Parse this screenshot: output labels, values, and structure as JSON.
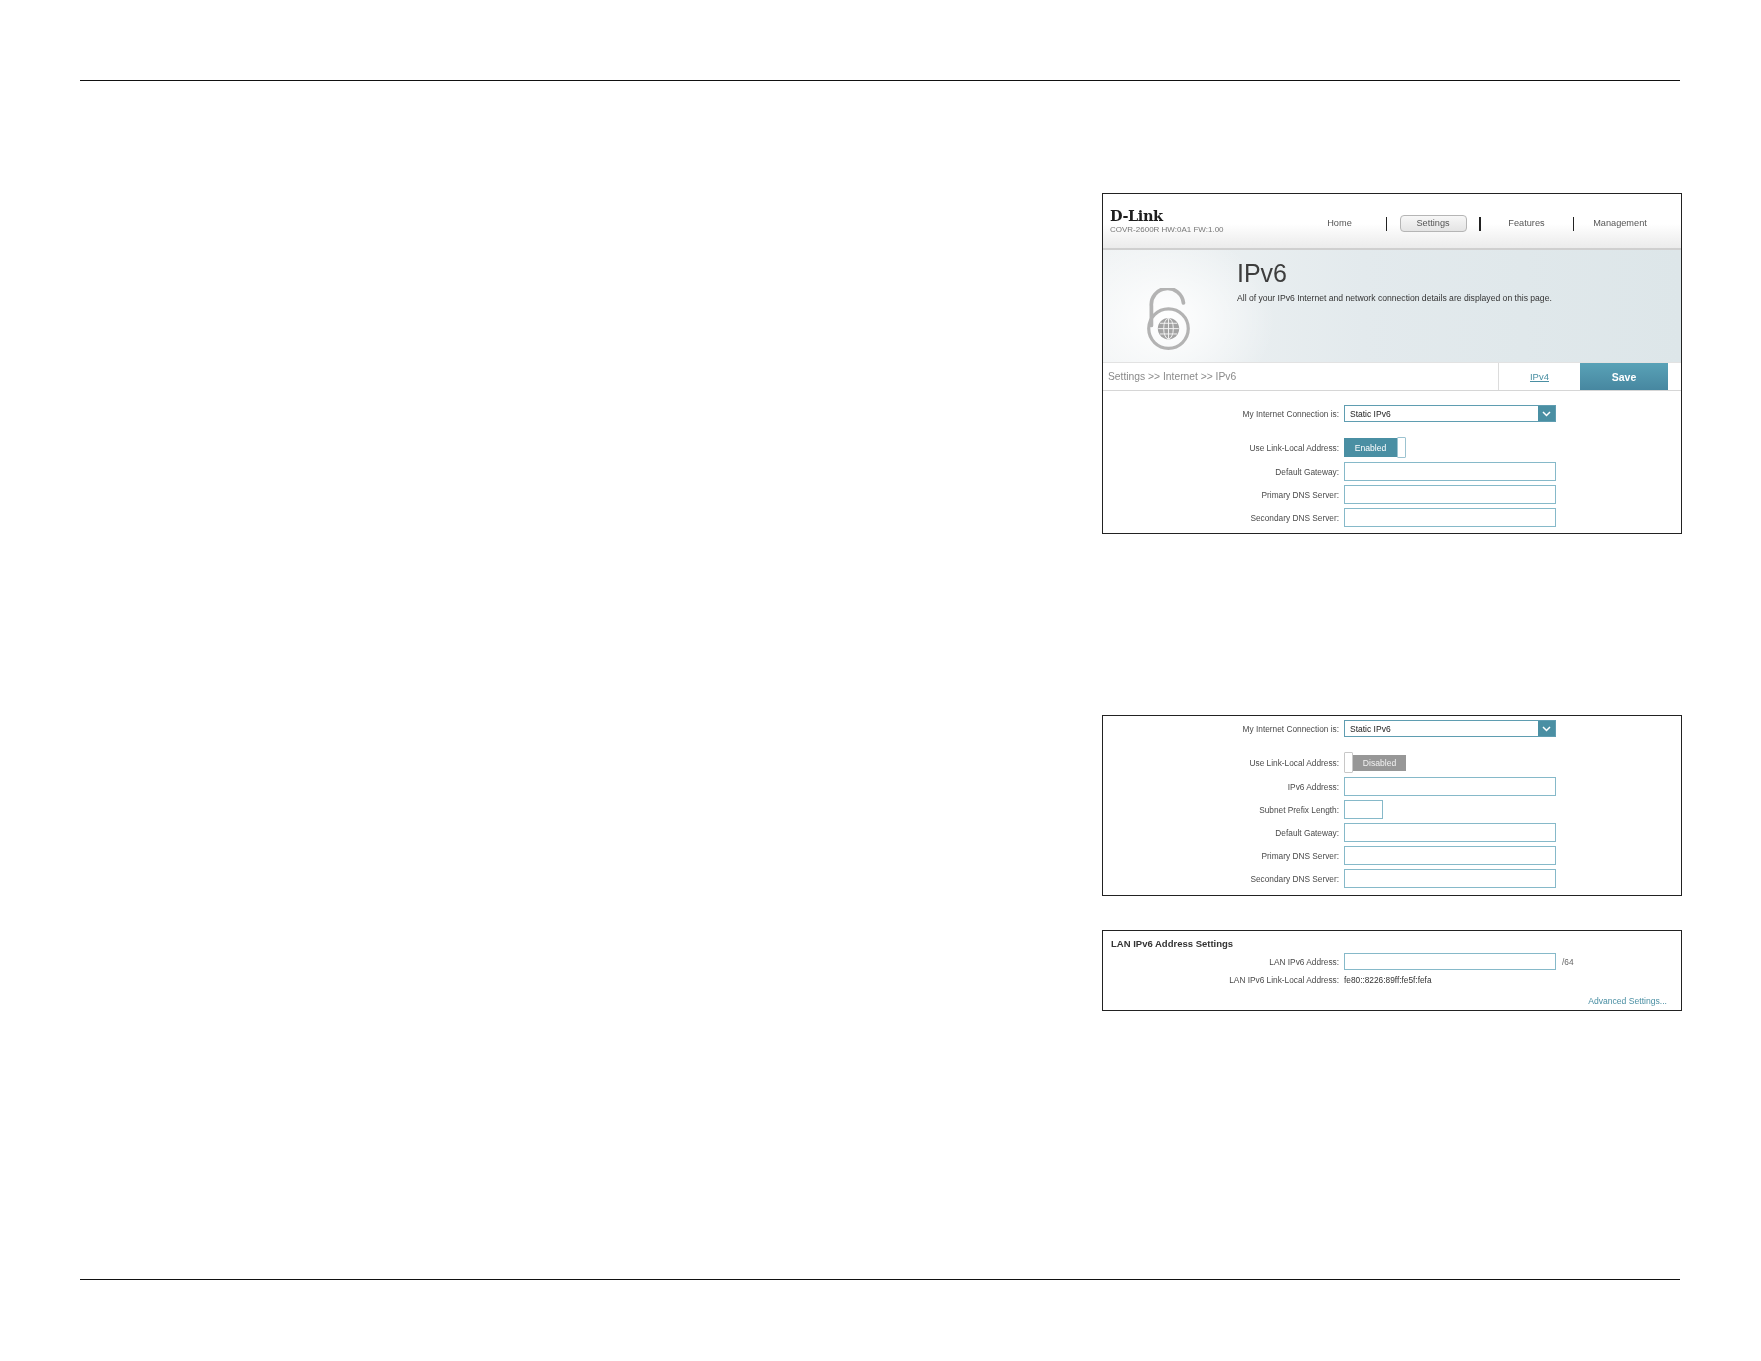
{
  "router_page": {
    "header": {
      "logo": "D-Link",
      "model": "COVR-2600R HW:0A1 FW:1.00",
      "nav": [
        {
          "label": "Home",
          "selected": false
        },
        {
          "label": "Settings",
          "selected": true
        },
        {
          "label": "Features",
          "selected": false
        },
        {
          "label": "Management",
          "selected": false
        }
      ]
    },
    "banner": {
      "title": "IPv6",
      "description": "All of your IPv6 Internet and network connection details are displayed on this page."
    },
    "breadcrumb_bar": {
      "path": "Settings >> Internet >> IPv6",
      "link": "IPv4",
      "save_button": "Save"
    },
    "fields": [
      {
        "kind": "select",
        "label": "My Internet Connection is:",
        "value": "Static IPv6"
      },
      {
        "kind": "toggle",
        "label": "Use Link-Local Address:",
        "on": true,
        "text": "Enabled"
      },
      {
        "kind": "input",
        "label": "Default Gateway:"
      },
      {
        "kind": "input",
        "label": "Primary DNS Server:"
      },
      {
        "kind": "input",
        "label": "Secondary DNS Server:"
      }
    ]
  },
  "link_local_disabled_view": {
    "fields": [
      {
        "kind": "select",
        "label": "My Internet Connection is:",
        "value": "Static IPv6"
      },
      {
        "kind": "toggle",
        "label": "Use Link-Local Address:",
        "on": false,
        "text": "Disabled"
      },
      {
        "kind": "input",
        "label": "IPv6 Address:"
      },
      {
        "kind": "short_input",
        "label": "Subnet Prefix Length:"
      },
      {
        "kind": "input",
        "label": "Default Gateway:"
      },
      {
        "kind": "input",
        "label": "Primary DNS Server:"
      },
      {
        "kind": "input",
        "label": "Secondary DNS Server:"
      }
    ]
  },
  "lan_ipv6_settings": {
    "title": "LAN IPv6 Address Settings",
    "fields": [
      {
        "kind": "input",
        "label": "LAN IPv6 Address:",
        "suffix": "/64"
      },
      {
        "kind": "text",
        "label": "LAN IPv6 Link-Local Address:",
        "value": "fe80::8226:89ff:fe5f:fefa"
      }
    ],
    "advanced_link": "Advanced Settings..."
  }
}
